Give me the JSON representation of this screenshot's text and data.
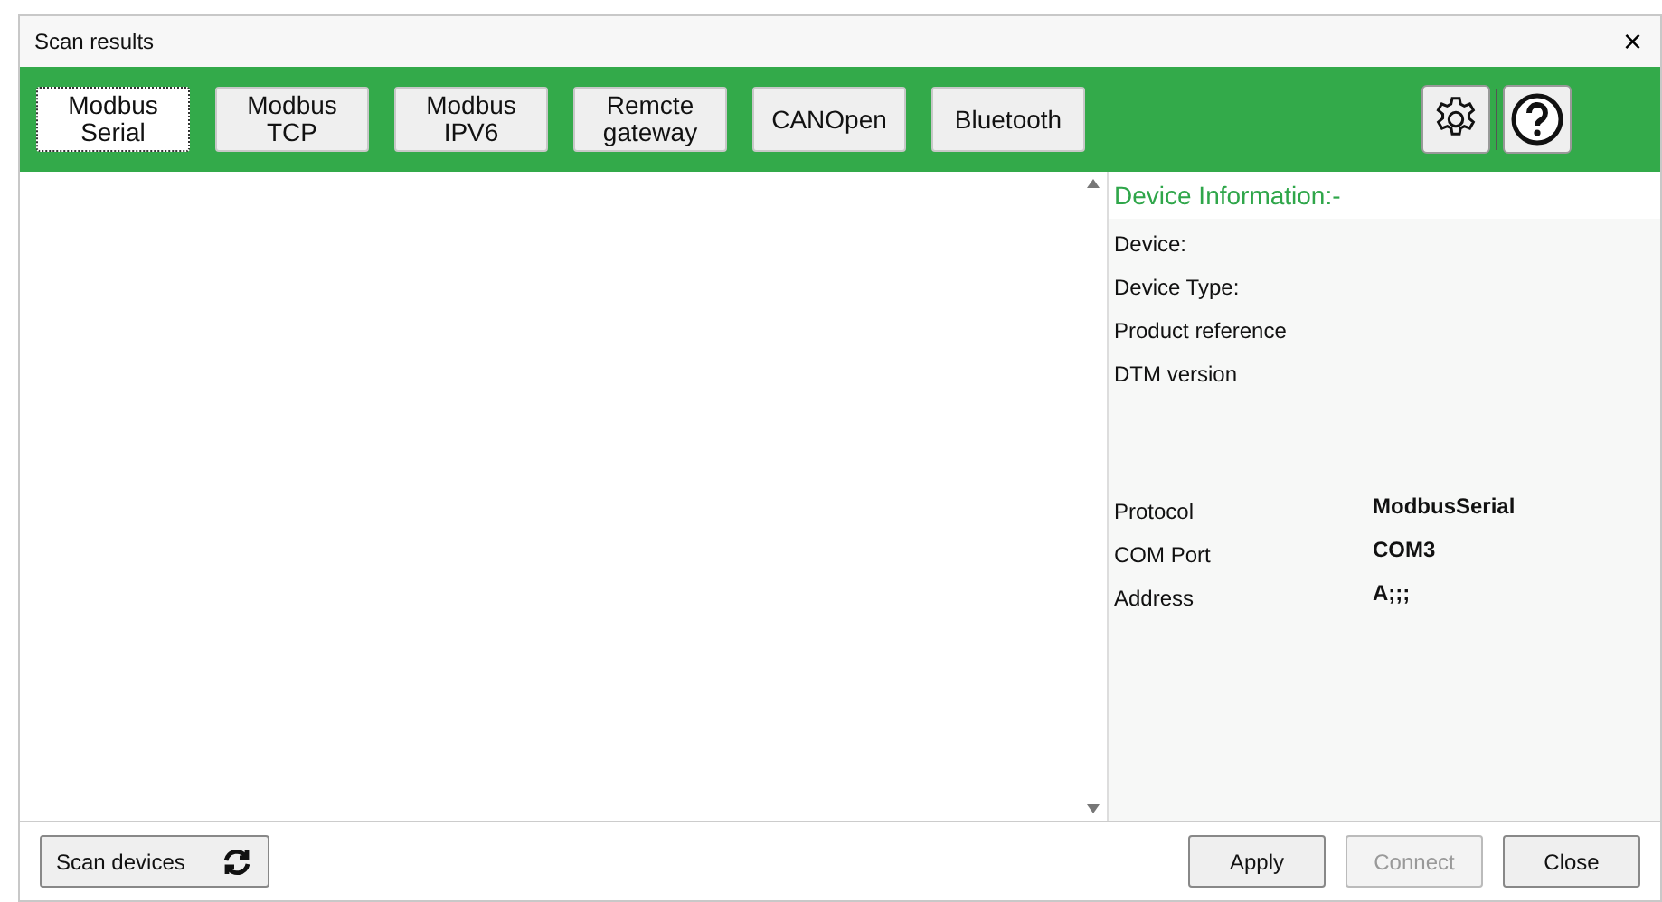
{
  "window": {
    "title": "Scan results",
    "close": "×"
  },
  "tabs": [
    {
      "label": "Modbus Serial",
      "selected": true
    },
    {
      "label": "Modbus TCP",
      "selected": false
    },
    {
      "label": "Modbus IPV6",
      "selected": false
    },
    {
      "label": "Remcte gateway",
      "selected": false
    },
    {
      "label": "CANOpen",
      "selected": false
    },
    {
      "label": "Bluetooth",
      "selected": false
    }
  ],
  "device_info": {
    "heading": "Device Information:-",
    "device_fields": [
      {
        "label": "Device:"
      },
      {
        "label": "Device Type:"
      },
      {
        "label": "Product reference"
      },
      {
        "label": "DTM version"
      }
    ],
    "connection_fields": [
      {
        "label": "Protocol",
        "value": "ModbusSerial"
      },
      {
        "label": "COM Port",
        "value": "COM3"
      },
      {
        "label": "Address",
        "value": "A;;;"
      }
    ]
  },
  "footer": {
    "scan_button": "Scan devices",
    "buttons": [
      {
        "label": "Apply",
        "disabled": false
      },
      {
        "label": "Connect",
        "disabled": true
      },
      {
        "label": "Close",
        "disabled": false
      }
    ]
  }
}
